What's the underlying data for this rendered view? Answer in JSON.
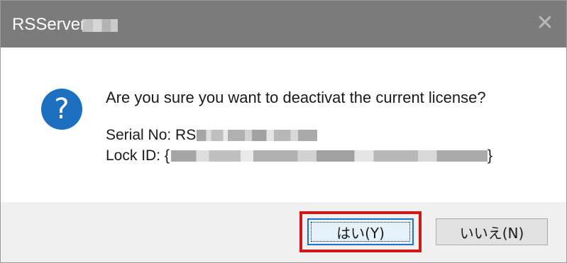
{
  "window": {
    "title": "RSServer",
    "close_glyph": "✕"
  },
  "icon": {
    "name": "question-icon",
    "glyph": "?",
    "color": "#1d6fc0"
  },
  "message": {
    "text": "Are you sure you want to deactivat the current license?",
    "serial_label": "Serial No: RS",
    "lock_label": "Lock ID: {",
    "lock_suffix": "}"
  },
  "buttons": {
    "yes_label": "はい(Y)",
    "no_label": "いいえ(N)"
  },
  "colors": {
    "titlebar": "#7b7b7b",
    "accent": "#1e73c9",
    "highlight": "#d01818"
  }
}
